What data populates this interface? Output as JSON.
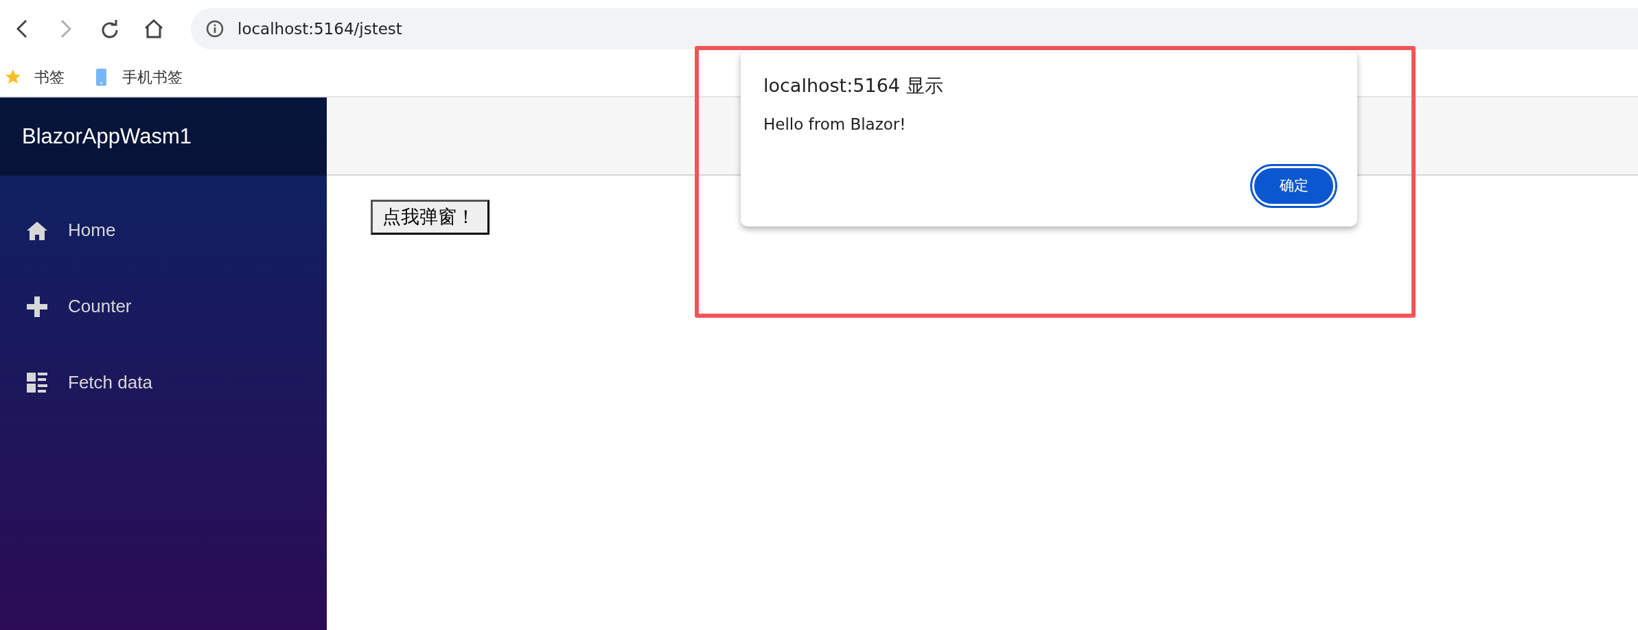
{
  "browser": {
    "nav_buttons": [
      {
        "kind": "back",
        "disabled": false
      },
      {
        "kind": "forward",
        "disabled": true
      },
      {
        "kind": "reload",
        "disabled": false
      },
      {
        "kind": "home",
        "disabled": false
      }
    ],
    "address": "localhost:5164/jstest",
    "bookmarks": [
      {
        "kind": "star",
        "label": "书签"
      },
      {
        "kind": "phone",
        "label": "手机书签"
      }
    ]
  },
  "app": {
    "brand": "BlazorAppWasm1",
    "nav": [
      {
        "kind": "home",
        "label": "Home"
      },
      {
        "kind": "plus",
        "label": "Counter"
      },
      {
        "kind": "list",
        "label": "Fetch data"
      }
    ],
    "button": "点我弹窗！"
  },
  "dialog": {
    "title": "localhost:5164 显示",
    "message": "Hello from Blazor!",
    "ok_button": "确定"
  },
  "annotations": [
    {
      "kind": "rectangle",
      "color": "#f25557"
    }
  ]
}
